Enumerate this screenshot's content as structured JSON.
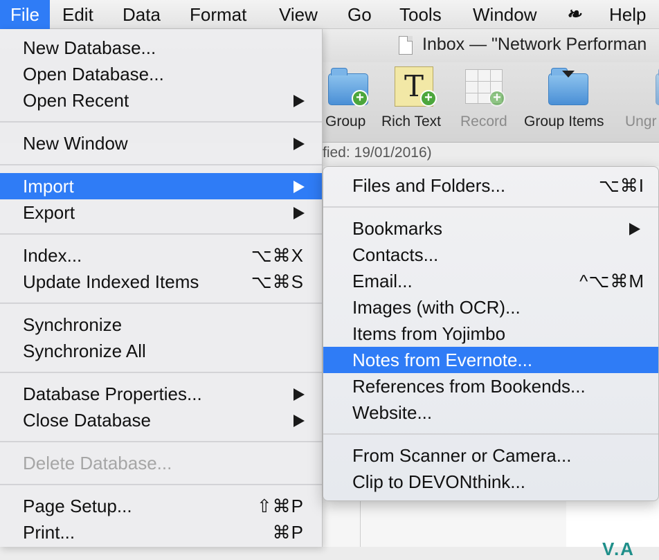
{
  "menubar": {
    "items": [
      "File",
      "Edit",
      "Data",
      "Format",
      "View",
      "Go",
      "Tools",
      "Window",
      "Help"
    ],
    "script_icon": "❧"
  },
  "window": {
    "title": "Inbox — \"Network Performan",
    "toolbar": [
      {
        "label": "Group",
        "icon": "folder-plus-icon"
      },
      {
        "label": "Rich Text",
        "icon": "rich-text-plus-icon"
      },
      {
        "label": "Record",
        "icon": "record-grid-plus-icon"
      },
      {
        "label": "Group Items",
        "icon": "folder-dropdown-icon"
      },
      {
        "label": "Ungr",
        "icon": "ungroup-icon"
      }
    ],
    "infobar_text": "fied: 19/01/2016)",
    "content_text": "V.A"
  },
  "file_menu": {
    "new_database": "New Database...",
    "open_database": "Open Database...",
    "open_recent": "Open Recent",
    "new_window": "New Window",
    "import": "Import",
    "export": "Export",
    "index": "Index...",
    "index_shortcut": "⌥⌘X",
    "update_indexed": "Update Indexed Items",
    "update_indexed_shortcut": "⌥⌘S",
    "synchronize": "Synchronize",
    "synchronize_all": "Synchronize All",
    "database_properties": "Database Properties...",
    "close_database": "Close Database",
    "delete_database": "Delete Database...",
    "page_setup": "Page Setup...",
    "page_setup_shortcut": "⇧⌘P",
    "print": "Print...",
    "print_shortcut": "⌘P"
  },
  "import_menu": {
    "files_and_folders": "Files and Folders...",
    "files_and_folders_shortcut": "⌥⌘I",
    "bookmarks": "Bookmarks",
    "contacts": "Contacts...",
    "email": "Email...",
    "email_shortcut": "^⌥⌘M",
    "images": "Images (with OCR)...",
    "yojimbo": "Items from Yojimbo",
    "evernote": "Notes from Evernote...",
    "bookends": "References from Bookends...",
    "website": "Website...",
    "scanner": "From Scanner or Camera...",
    "clip": "Clip to DEVONthink..."
  },
  "colors": {
    "highlight": "#2f7cf6",
    "menu_background": "#ececee",
    "disabled_text": "#a6a6a6"
  }
}
